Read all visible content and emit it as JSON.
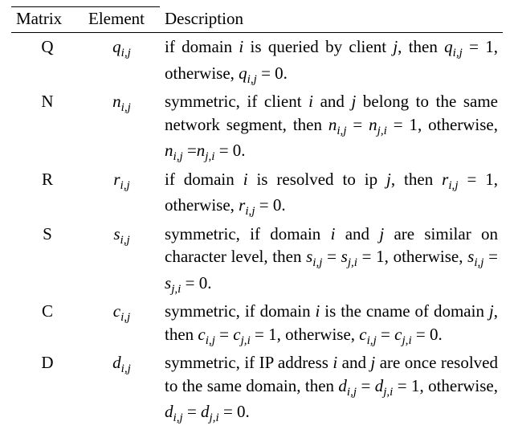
{
  "headers": {
    "matrix": "Matrix",
    "element": "Element",
    "description": "Description"
  },
  "rows": [
    {
      "matrix": "Q",
      "element_html": "<span class=\"sub\">q<sub>i,j</sub></span>",
      "description_html": "if domain <i>i</i> is queried by client <i>j</i>, then <span class=\"sub\">q<sub>i,j</sub></span> = 1, otherwise, <span class=\"sub\">q<sub>i,j</sub></span> = 0."
    },
    {
      "matrix": "N",
      "element_html": "<span class=\"sub\">n<sub>i,j</sub></span>",
      "description_html": "symmetric, if client <i>i</i> and <i>j</i> belong to the same network segment, then <span class=\"sub\">n<sub>i,j</sub></span> = <span class=\"sub\">n<sub>j,i</sub></span> = 1, otherwise, <span class=\"sub\">n<sub>i,j</sub></span> =<span class=\"sub\">n<sub>j,i</sub></span> = 0."
    },
    {
      "matrix": "R",
      "element_html": "<span class=\"sub\">r<sub>i,j</sub></span>",
      "description_html": "if domain <i>i</i> is resolved to ip <i>j</i>, then <span class=\"sub\">r<sub>i,j</sub></span> = 1, otherwise, <span class=\"sub\">r<sub>i,j</sub></span> = 0."
    },
    {
      "matrix": "S",
      "element_html": "<span class=\"sub\">s<sub>i,j</sub></span>",
      "description_html": "symmetric, if domain <i>i</i> and <i>j</i> are simi&shy;lar on character level, then <span class=\"sub\">s<sub>i,j</sub></span> = <span class=\"sub\">s<sub>j,i</sub></span> = 1, otherwise, <span class=\"sub\">s<sub>i,j</sub></span> = <span class=\"sub\">s<sub>j,i</sub></span> = 0."
    },
    {
      "matrix": "C",
      "element_html": "<span class=\"sub\">c<sub>i,j</sub></span>",
      "description_html": "symmetric, if domain <i>i</i> is the cname of domain <i>j</i>, then <span class=\"sub\">c<sub>i,j</sub></span> = <span class=\"sub\">c<sub>j,i</sub></span> = 1, other&shy;wise, <span class=\"sub\">c<sub>i,j</sub></span> = <span class=\"sub\">c<sub>j,i</sub></span> = 0."
    },
    {
      "matrix": "D",
      "element_html": "<span class=\"sub\">d<sub>i,j</sub></span>",
      "description_html": "symmetric, if IP address <i>i</i> and <i>j</i> are once resolved to the same domain, then <span class=\"sub\">d<sub>i,j</sub></span> = <span class=\"sub\">d<sub>j,i</sub></span> = 1, otherwise, <span class=\"sub\">d<sub>i,j</sub></span> = <span class=\"sub\">d<sub>j,i</sub></span> = 0."
    }
  ],
  "chart_data": {
    "type": "table",
    "columns": [
      "Matrix",
      "Element",
      "Description"
    ],
    "rows": [
      [
        "Q",
        "q_{i,j}",
        "if domain i is queried by client j, then q_{i,j} = 1, otherwise, q_{i,j} = 0."
      ],
      [
        "N",
        "n_{i,j}",
        "symmetric, if client i and j belong to the same network segment, then n_{i,j} = n_{j,i} = 1, otherwise, n_{i,j} = n_{j,i} = 0."
      ],
      [
        "R",
        "r_{i,j}",
        "if domain i is resolved to ip j, then r_{i,j} = 1, otherwise, r_{i,j} = 0."
      ],
      [
        "S",
        "s_{i,j}",
        "symmetric, if domain i and j are similar on character level, then s_{i,j} = s_{j,i} = 1, otherwise, s_{i,j} = s_{j,i} = 0."
      ],
      [
        "C",
        "c_{i,j}",
        "symmetric, if domain i is the cname of domain j, then c_{i,j} = c_{j,i} = 1, otherwise, c_{i,j} = c_{j,i} = 0."
      ],
      [
        "D",
        "d_{i,j}",
        "symmetric, if IP address i and j are once resolved to the same domain, then d_{i,j} = d_{j,i} = 1, otherwise, d_{i,j} = d_{j,i} = 0."
      ]
    ]
  }
}
